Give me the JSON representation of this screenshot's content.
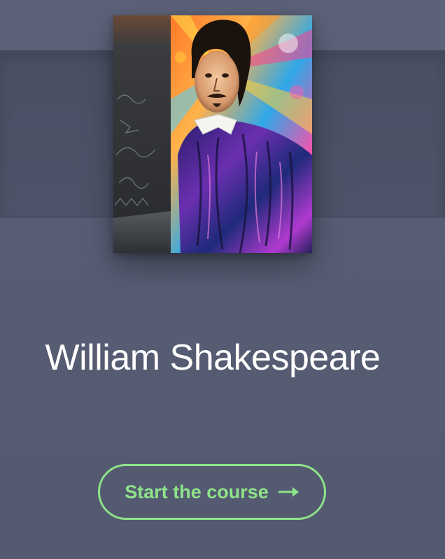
{
  "course": {
    "title": "William Shakespeare",
    "cover_image": "shakespeare-graffiti-mural"
  },
  "actions": {
    "start_label": "Start the course",
    "start_icon": "arrow-right-icon"
  },
  "colors": {
    "background": "#535a70",
    "top_strip": "#5c6279",
    "hero_band": "#4a5064",
    "title_text": "#ffffff",
    "accent_green": "#8ee38a"
  }
}
